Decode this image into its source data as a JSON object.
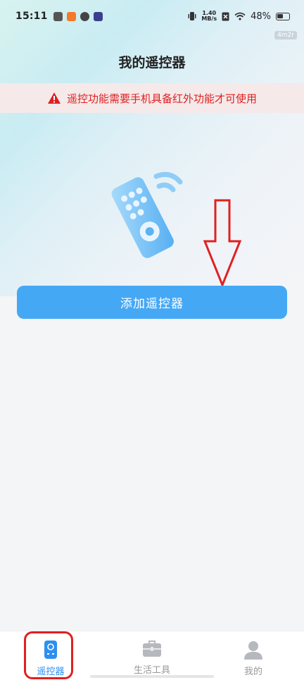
{
  "status_bar": {
    "time": "15:11",
    "net_speed_value": "1.40",
    "net_speed_unit": "MB/s",
    "battery": "48%"
  },
  "watermark": "4m2r",
  "header": {
    "title": "我的遥控器"
  },
  "warning": {
    "text": "遥控功能需要手机具备红外功能才可使用",
    "color": "#e02020"
  },
  "main": {
    "add_button_label": "添加遥控器",
    "accent": "#45a8f5"
  },
  "bottom_nav": {
    "items": [
      {
        "label": "遥控器",
        "icon": "remote-icon",
        "active": true
      },
      {
        "label": "生活工具",
        "icon": "toolbox-icon",
        "active": false
      },
      {
        "label": "我的",
        "icon": "person-icon",
        "active": false
      }
    ]
  }
}
